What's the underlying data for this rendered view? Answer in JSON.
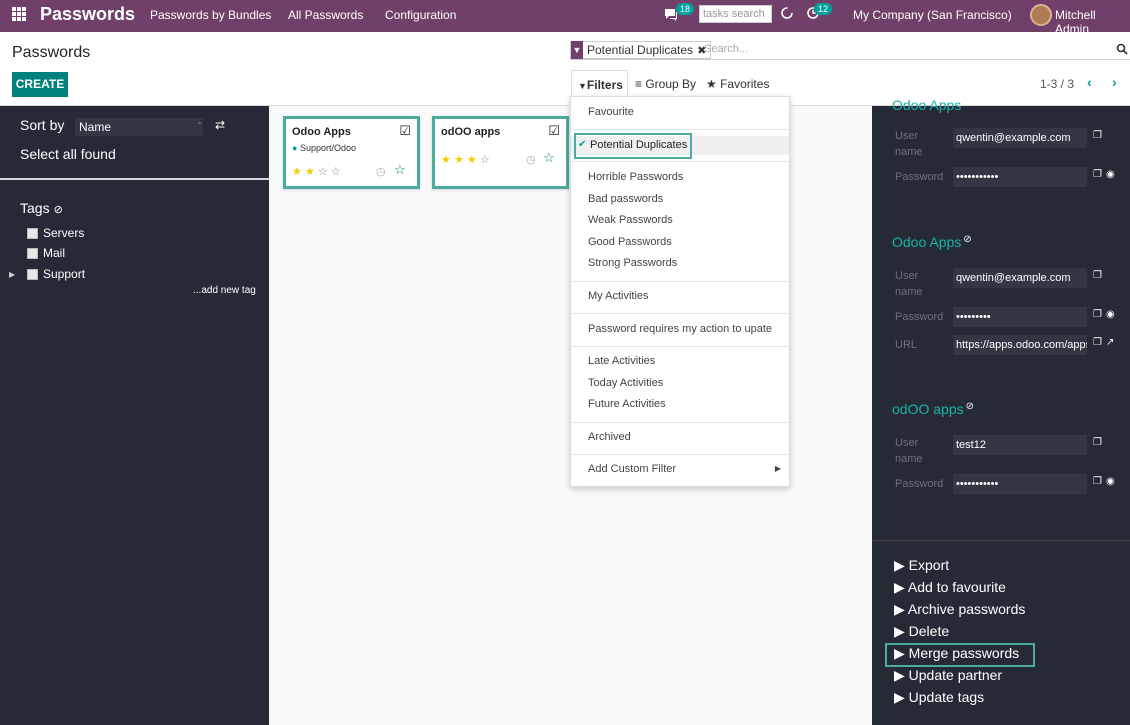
{
  "navbar": {
    "brand": "Passwords",
    "menu": [
      "Passwords by Bundles",
      "All Passwords",
      "Configuration"
    ],
    "chat_count": "18",
    "search_placeholder": "tasks search",
    "activity_count": "12",
    "company": "My Company (San Francisco)",
    "user": "Mitchell Admin"
  },
  "control_panel": {
    "title": "Passwords",
    "create_label": "CREATE",
    "facet_label": "Potential Duplicates",
    "search_placeholder": "Search...",
    "filters_label": "Filters",
    "groupby_label": "Group By",
    "favorites_label": "Favorites",
    "pager": "1-3 / 3"
  },
  "sidebar": {
    "sort_label": "Sort by",
    "sort_value": "Name",
    "select_all": "Select all found",
    "tags_title": "Tags",
    "tags": [
      "Servers",
      "Mail",
      "Support"
    ],
    "add_tag": "...add new tag"
  },
  "cards": [
    {
      "title": "Odoo Apps",
      "subtitle": "Support/Odoo",
      "stars": 2
    },
    {
      "title": "odOO apps",
      "subtitle": "",
      "stars": 3
    }
  ],
  "filters_dropdown": {
    "items": [
      "Favourite",
      "Potential Duplicates",
      "Horrible Passwords",
      "Bad passwords",
      "Weak Passwords",
      "Good Passwords",
      "Strong Passwords",
      "My Activities",
      "Password requires my action to upate",
      "Late Activities",
      "Today Activities",
      "Future Activities",
      "Archived",
      "Add Custom Filter"
    ]
  },
  "right_panel": {
    "partial_title": "Odoo Apps",
    "entry1": {
      "user": "qwentin@example.com",
      "password": "•••••••••••"
    },
    "entry2": {
      "title": "Odoo Apps",
      "user": "qwentin@example.com",
      "password": "•••••••••",
      "url": "https://apps.odoo.com/apps"
    },
    "entry3": {
      "title": "odOO apps",
      "user": "test12",
      "password": "•••••••••••"
    },
    "labels": {
      "user": "User name",
      "password": "Password",
      "url": "URL"
    }
  },
  "actions": [
    "Export",
    "Add to favourite",
    "Archive passwords",
    "Delete",
    "Merge passwords",
    "Update partner",
    "Update tags"
  ],
  "colors": {
    "brand": "#71406a",
    "accent": "#00a09d",
    "highlight": "#4aab9e",
    "dark_panel": "#262a36"
  }
}
